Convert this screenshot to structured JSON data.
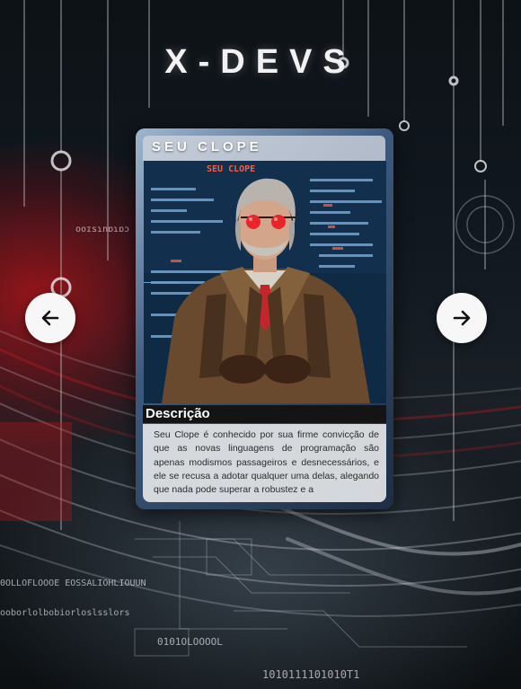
{
  "header": {
    "title": "X-DEVS"
  },
  "carousel": {
    "prev_icon": "arrow-left-icon",
    "next_icon": "arrow-right-icon"
  },
  "card": {
    "name": "SEU CLOPE",
    "portrait_label": "SEU CLOPE",
    "description_title": "Descrição",
    "description": "Seu Clope é conhecido por sua firme convicção de que as novas linguagens de programação são apenas modismos passageiros e desnecessários, e ele se recusa a adotar qualquer uma delas, alegando que nada pode superar a robustez e a"
  },
  "background": {
    "texts": [
      "ooɪsɿnɒɿɒɔ",
      "0OLLOFLOOOE EOSSALIOHLIOUUN",
      "ooborlolbobiorloslsslors",
      "0101OLOOOOL",
      "1010111101010T1"
    ]
  },
  "colors": {
    "accent_red": "#b01418",
    "title_white": "#f2f2f4",
    "button_bg": "#f7f7f7"
  }
}
